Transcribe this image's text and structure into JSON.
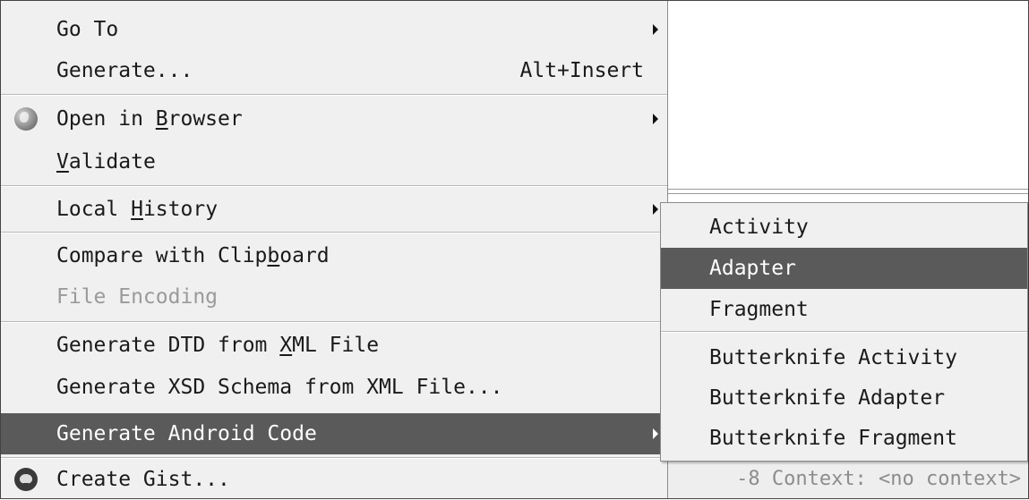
{
  "context_menu": {
    "goto_label": "Go To",
    "generate_label": "Generate...",
    "generate_shortcut": "Alt+Insert",
    "open_browser": {
      "pre": "Open in ",
      "mnemonic": "B",
      "post": "rowser"
    },
    "validate": {
      "mnemonic": "V",
      "post": "alidate"
    },
    "local_history": {
      "pre": "Local ",
      "mnemonic": "H",
      "post": "istory"
    },
    "compare_clipboard": {
      "pre": "Compare with Clip",
      "mnemonic": "b",
      "post": "oard"
    },
    "file_encoding_label": "File Encoding",
    "generate_dtd": {
      "pre": "Generate DTD from ",
      "mnemonic": "X",
      "post": "ML File"
    },
    "generate_xsd_label": "Generate XSD Schema from XML File...",
    "generate_android_label": "Generate Android Code",
    "create_gist_label": "Create Gist..."
  },
  "submenu": {
    "items": [
      "Activity",
      "Adapter",
      "Fragment"
    ],
    "butterknife_items": [
      "Butterknife Activity",
      "Butterknife Adapter",
      "Butterknife Fragment"
    ],
    "selected": "Adapter"
  },
  "statusbar": {
    "text": "-8 Context: <no context>"
  },
  "icons": {
    "open_in_browser": "globe-icon",
    "create_gist": "github-octocat-icon",
    "submenu_arrow": "chevron-right-icon"
  },
  "colors": {
    "menu_bg": "#f0f0f0",
    "highlight": "#5a5a5a",
    "highlight_text": "#ffffff",
    "disabled_text": "#9a9a9a"
  }
}
